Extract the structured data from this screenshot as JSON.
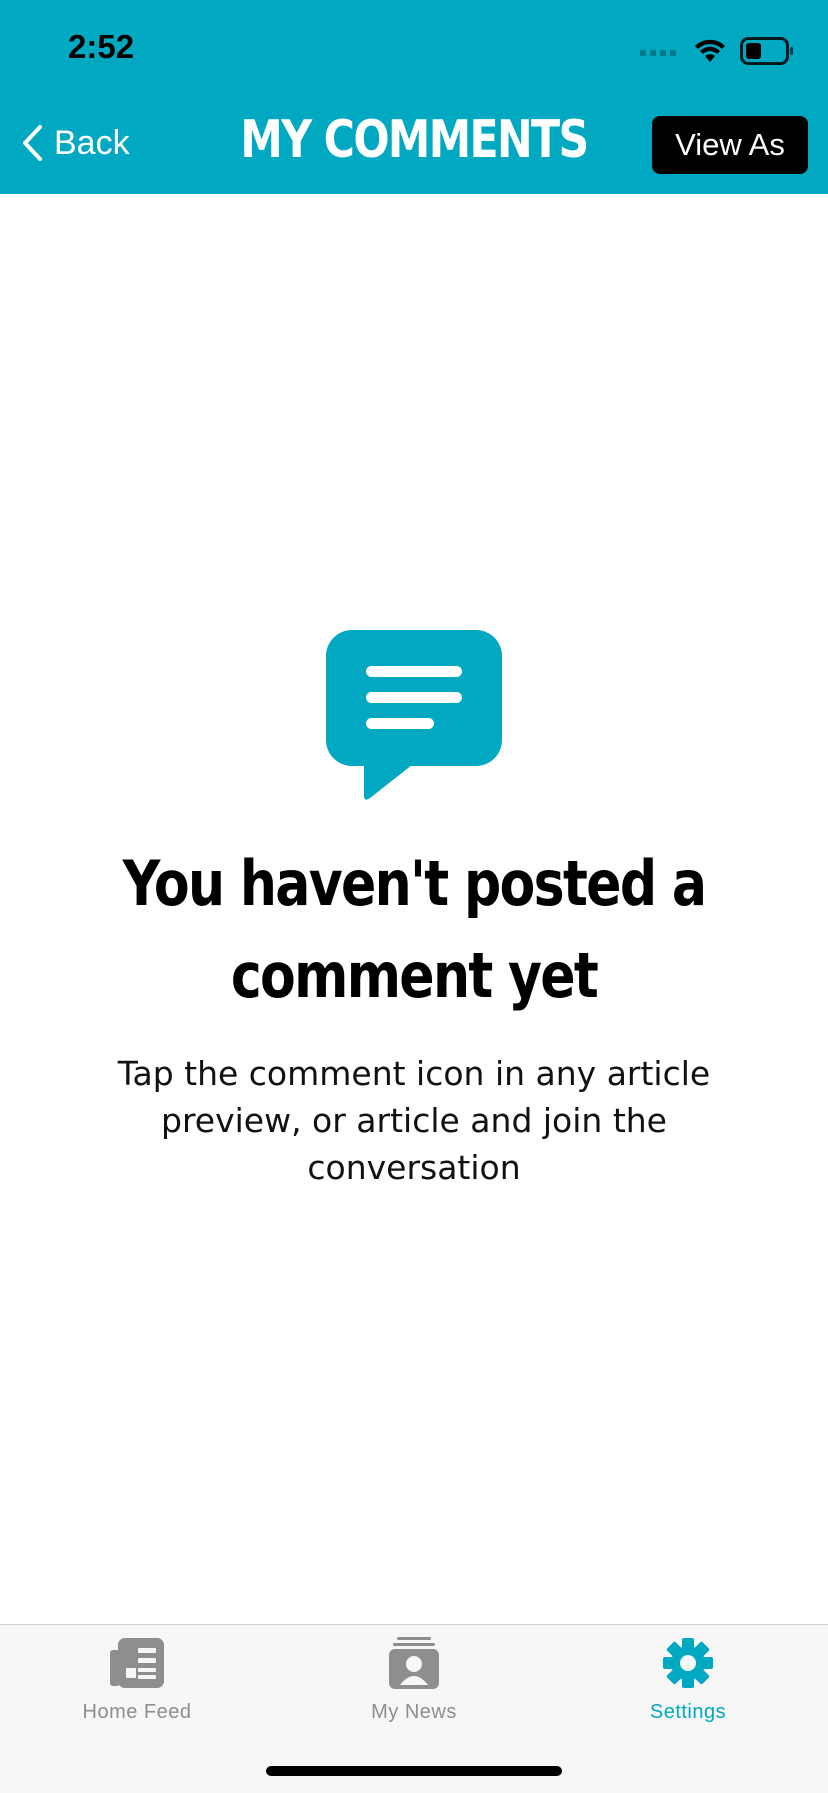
{
  "status_bar": {
    "time": "2:52"
  },
  "nav": {
    "back_label": "Back",
    "title": "MY COMMENTS",
    "view_as_label": "View As"
  },
  "empty_state": {
    "icon": "comment-bubble-icon",
    "title": "You haven't posted a comment yet",
    "message": "Tap the comment icon in any article preview, or article and join the conversation"
  },
  "tabs": [
    {
      "label": "Home Feed",
      "icon": "newspaper-icon",
      "active": false
    },
    {
      "label": "My News",
      "icon": "contact-card-icon",
      "active": false
    },
    {
      "label": "Settings",
      "icon": "gear-icon",
      "active": true
    }
  ],
  "colors": {
    "accent": "#00a9c1",
    "inactive": "#8e8e8e",
    "button_bg": "#000000"
  }
}
